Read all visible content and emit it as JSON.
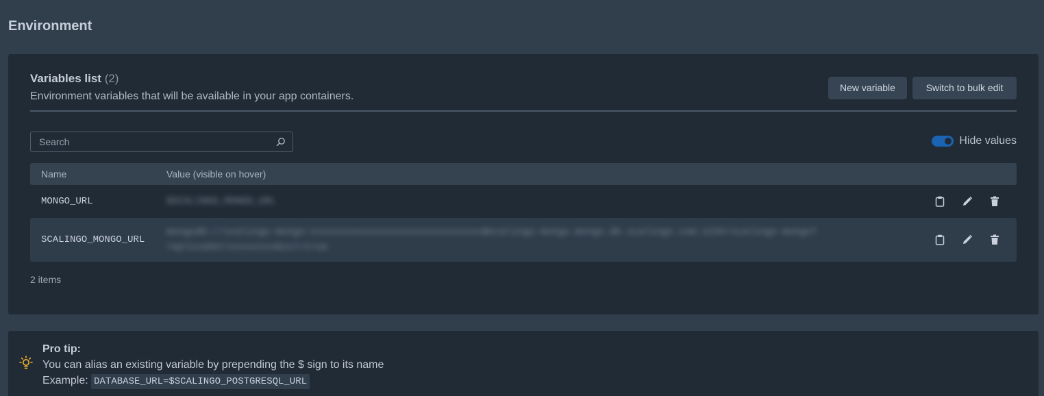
{
  "page": {
    "title": "Environment"
  },
  "variables": {
    "title": "Variables list",
    "count": "(2)",
    "subtitle": "Environment variables that will be available in your app containers.",
    "new_button": "New variable",
    "bulk_button": "Switch to bulk edit",
    "search_placeholder": "Search",
    "hide_values_label": "Hide values",
    "hide_values_on": true,
    "columns": {
      "name": "Name",
      "value": "Value (visible on hover)"
    },
    "rows": [
      {
        "name": "MONGO_URL",
        "value": "$SCALINGO_MONGO_URL"
      },
      {
        "name": "SCALINGO_MONGO_URL",
        "value": "mongodb://scalingo-mongo:xxxxxxxxxxxxxxxxxxxxxxxxxxxxxx@scalingo-mongo.mongo.db.scalingo.com:1234/scalingo-mongo?replicaSet=xxxxxxxx&ssl=true"
      }
    ],
    "items_count": "2 items"
  },
  "tip": {
    "title": "Pro tip:",
    "line1": "You can alias an existing variable by prepending the $ sign to its name",
    "example_label": "Example:",
    "example_code": "DATABASE_URL=$SCALINGO_POSTGRESQL_URL"
  },
  "colors": {
    "background": "#313e4c",
    "card": "#212b36",
    "accent_toggle": "#1b63b3",
    "tip_icon": "#f0b429"
  },
  "icons": [
    "search-icon",
    "clipboard-icon",
    "pencil-icon",
    "trash-icon",
    "lightbulb-icon"
  ]
}
